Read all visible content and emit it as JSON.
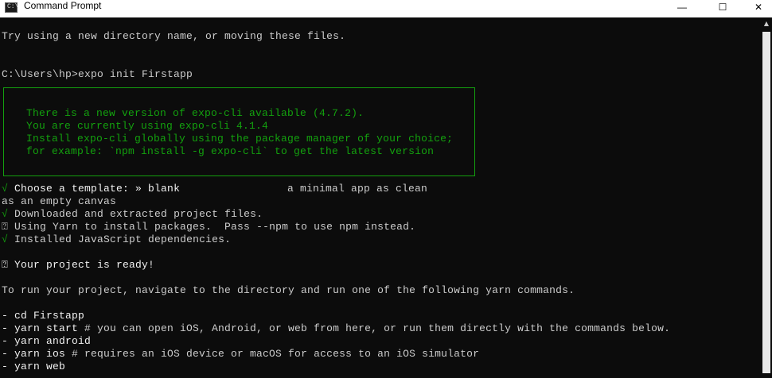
{
  "window": {
    "title": "Command Prompt",
    "icon_label": "C:\\",
    "minimize_glyph": "—",
    "maximize_glyph": "☐",
    "close_glyph": "✕"
  },
  "colors": {
    "background": "#0c0c0c",
    "text": "#cccccc",
    "green": "#13a10e"
  },
  "terminal": {
    "l1": "Try using a new directory name, or moving these files.",
    "l2": "C:\\Users\\hp>expo init Firstapp",
    "notice": [
      "There is a new version of expo-cli available (4.7.2).",
      "You are currently using expo-cli 4.1.4",
      "Install expo-cli globally using the package manager of your choice;",
      "for example: `npm install -g expo-cli` to get the latest version"
    ],
    "check": "√",
    "box_glyph": "⍰",
    "template_prompt": "Choose a template: » blank",
    "template_desc": "a minimal app as clean",
    "template_desc2": "as an empty canvas",
    "downloaded": "Downloaded and extracted project files.",
    "yarn_info": "Using Yarn to install packages.  Pass --npm to use npm instead.",
    "installed": "Installed JavaScript dependencies.",
    "ready": "Your project is ready!",
    "run_info": "To run your project, navigate to the directory and run one of the following yarn commands.",
    "cmd_cd": "- cd Firstapp",
    "cmd_start": "- yarn start",
    "cmd_start_comment": " # you can open iOS, Android, or web from here, or run them directly with the commands below.",
    "cmd_android": "- yarn android",
    "cmd_ios": "- yarn ios",
    "cmd_ios_comment": " # requires an iOS device or macOS for access to an iOS simulator",
    "cmd_web": "- yarn web"
  }
}
